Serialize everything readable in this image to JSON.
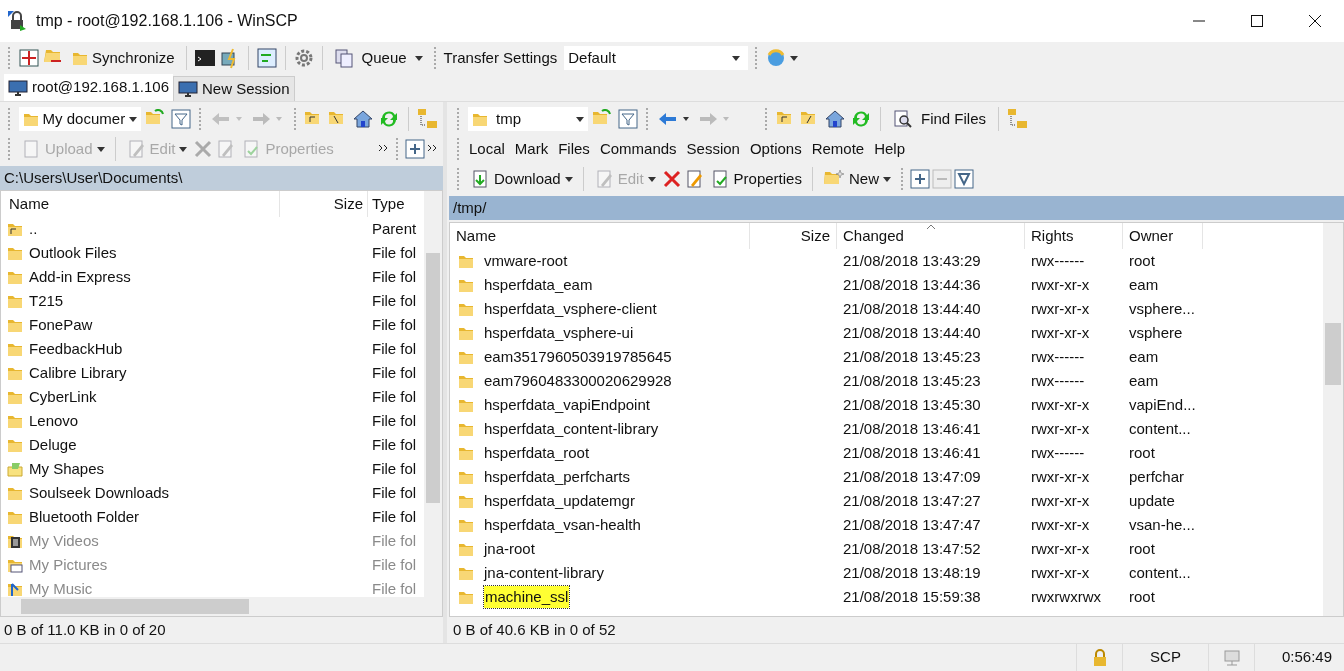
{
  "window": {
    "title": "tmp - root@192.168.1.106 - WinSCP"
  },
  "main_toolbar": {
    "synchronize": "Synchronize",
    "queue": "Queue",
    "transfer_settings_label": "Transfer Settings",
    "transfer_settings_value": "Default"
  },
  "tabs": [
    {
      "label": "root@192.168.1.106",
      "selected": true
    },
    {
      "label": "New Session",
      "selected": false
    }
  ],
  "local": {
    "location": "My documer",
    "toolbar": [
      {
        "label": "Upload",
        "disabled": true
      },
      {
        "label": "Edit",
        "disabled": true
      },
      {
        "label": "Properties",
        "disabled": true
      }
    ],
    "path": "C:\\Users\\User\\Documents\\",
    "columns": [
      "Name",
      "Size",
      "Type"
    ],
    "rows": [
      {
        "kind": "parent",
        "name": "..",
        "type": "Parent",
        "dimmed": false
      },
      {
        "kind": "folder",
        "name": "Outlook Files",
        "type": "File fol",
        "dimmed": false
      },
      {
        "kind": "folder",
        "name": "Add-in Express",
        "type": "File fol",
        "dimmed": false
      },
      {
        "kind": "folder",
        "name": "T215",
        "type": "File fol",
        "dimmed": false
      },
      {
        "kind": "folder",
        "name": "FonePaw",
        "type": "File fol",
        "dimmed": false
      },
      {
        "kind": "folder",
        "name": "FeedbackHub",
        "type": "File fol",
        "dimmed": false
      },
      {
        "kind": "folder",
        "name": "Calibre Library",
        "type": "File fol",
        "dimmed": false
      },
      {
        "kind": "folder",
        "name": "CyberLink",
        "type": "File fol",
        "dimmed": false
      },
      {
        "kind": "folder",
        "name": "Lenovo",
        "type": "File fol",
        "dimmed": false
      },
      {
        "kind": "folder",
        "name": "Deluge",
        "type": "File fol",
        "dimmed": false
      },
      {
        "kind": "shapes",
        "name": "My Shapes",
        "type": "File fol",
        "dimmed": false
      },
      {
        "kind": "folder",
        "name": "Soulseek Downloads",
        "type": "File fol",
        "dimmed": false
      },
      {
        "kind": "folder",
        "name": "Bluetooth Folder",
        "type": "File fol",
        "dimmed": false
      },
      {
        "kind": "videos",
        "name": "My Videos",
        "type": "File fol",
        "dimmed": true
      },
      {
        "kind": "pictures",
        "name": "My Pictures",
        "type": "File fol",
        "dimmed": true
      },
      {
        "kind": "music",
        "name": "My Music",
        "type": "File fol",
        "dimmed": true
      }
    ],
    "status": "0 B of 11.0 KB in 0 of 20"
  },
  "remote": {
    "location": "tmp",
    "find_files": "Find Files",
    "menu": [
      "Local",
      "Mark",
      "Files",
      "Commands",
      "Session",
      "Options",
      "Remote",
      "Help"
    ],
    "toolbar": [
      {
        "label": "Download",
        "disabled": false
      },
      {
        "label": "Edit",
        "disabled": true
      },
      {
        "label": "Properties",
        "disabled": false
      },
      {
        "label": "New",
        "disabled": false
      }
    ],
    "path": "/tmp/",
    "columns": [
      {
        "label": "Name",
        "sorted": false
      },
      {
        "label": "Size",
        "sorted": false
      },
      {
        "label": "Changed",
        "sorted": true
      },
      {
        "label": "Rights",
        "sorted": false
      },
      {
        "label": "Owner",
        "sorted": false
      }
    ],
    "rows": [
      {
        "name": "vmware-root",
        "changed": "21/08/2018 13:43:29",
        "rights": "rwx------",
        "owner": "root",
        "focused": false
      },
      {
        "name": "hsperfdata_eam",
        "changed": "21/08/2018 13:44:36",
        "rights": "rwxr-xr-x",
        "owner": "eam",
        "focused": false
      },
      {
        "name": "hsperfdata_vsphere-client",
        "changed": "21/08/2018 13:44:40",
        "rights": "rwxr-xr-x",
        "owner": "vsphere...",
        "focused": false
      },
      {
        "name": "hsperfdata_vsphere-ui",
        "changed": "21/08/2018 13:44:40",
        "rights": "rwxr-xr-x",
        "owner": "vsphere",
        "focused": false
      },
      {
        "name": "eam3517960503919785645",
        "changed": "21/08/2018 13:45:23",
        "rights": "rwx------",
        "owner": "eam",
        "focused": false
      },
      {
        "name": "eam7960483300020629928",
        "changed": "21/08/2018 13:45:23",
        "rights": "rwx------",
        "owner": "eam",
        "focused": false
      },
      {
        "name": "hsperfdata_vapiEndpoint",
        "changed": "21/08/2018 13:45:30",
        "rights": "rwxr-xr-x",
        "owner": "vapiEnd...",
        "focused": false
      },
      {
        "name": "hsperfdata_content-library",
        "changed": "21/08/2018 13:46:41",
        "rights": "rwxr-xr-x",
        "owner": "content...",
        "focused": false
      },
      {
        "name": "hsperfdata_root",
        "changed": "21/08/2018 13:46:41",
        "rights": "rwx------",
        "owner": "root",
        "focused": false
      },
      {
        "name": "hsperfdata_perfcharts",
        "changed": "21/08/2018 13:47:09",
        "rights": "rwxr-xr-x",
        "owner": "perfchar",
        "focused": false
      },
      {
        "name": "hsperfdata_updatemgr",
        "changed": "21/08/2018 13:47:27",
        "rights": "rwxr-xr-x",
        "owner": "update",
        "focused": false
      },
      {
        "name": "hsperfdata_vsan-health",
        "changed": "21/08/2018 13:47:47",
        "rights": "rwxr-xr-x",
        "owner": "vsan-he...",
        "focused": false
      },
      {
        "name": "jna-root",
        "changed": "21/08/2018 13:47:52",
        "rights": "rwxr-xr-x",
        "owner": "root",
        "focused": false
      },
      {
        "name": "jna-content-library",
        "changed": "21/08/2018 13:48:19",
        "rights": "rwxr-xr-x",
        "owner": "content...",
        "focused": false
      },
      {
        "name": "machine_ssl",
        "changed": "21/08/2018 15:59:38",
        "rights": "rwxrwxrwx",
        "owner": "root",
        "focused": true
      }
    ],
    "status": "0 B of 40.6 KB in 0 of 52"
  },
  "status_bar": {
    "protocol": "SCP",
    "time": "0:56:49"
  }
}
